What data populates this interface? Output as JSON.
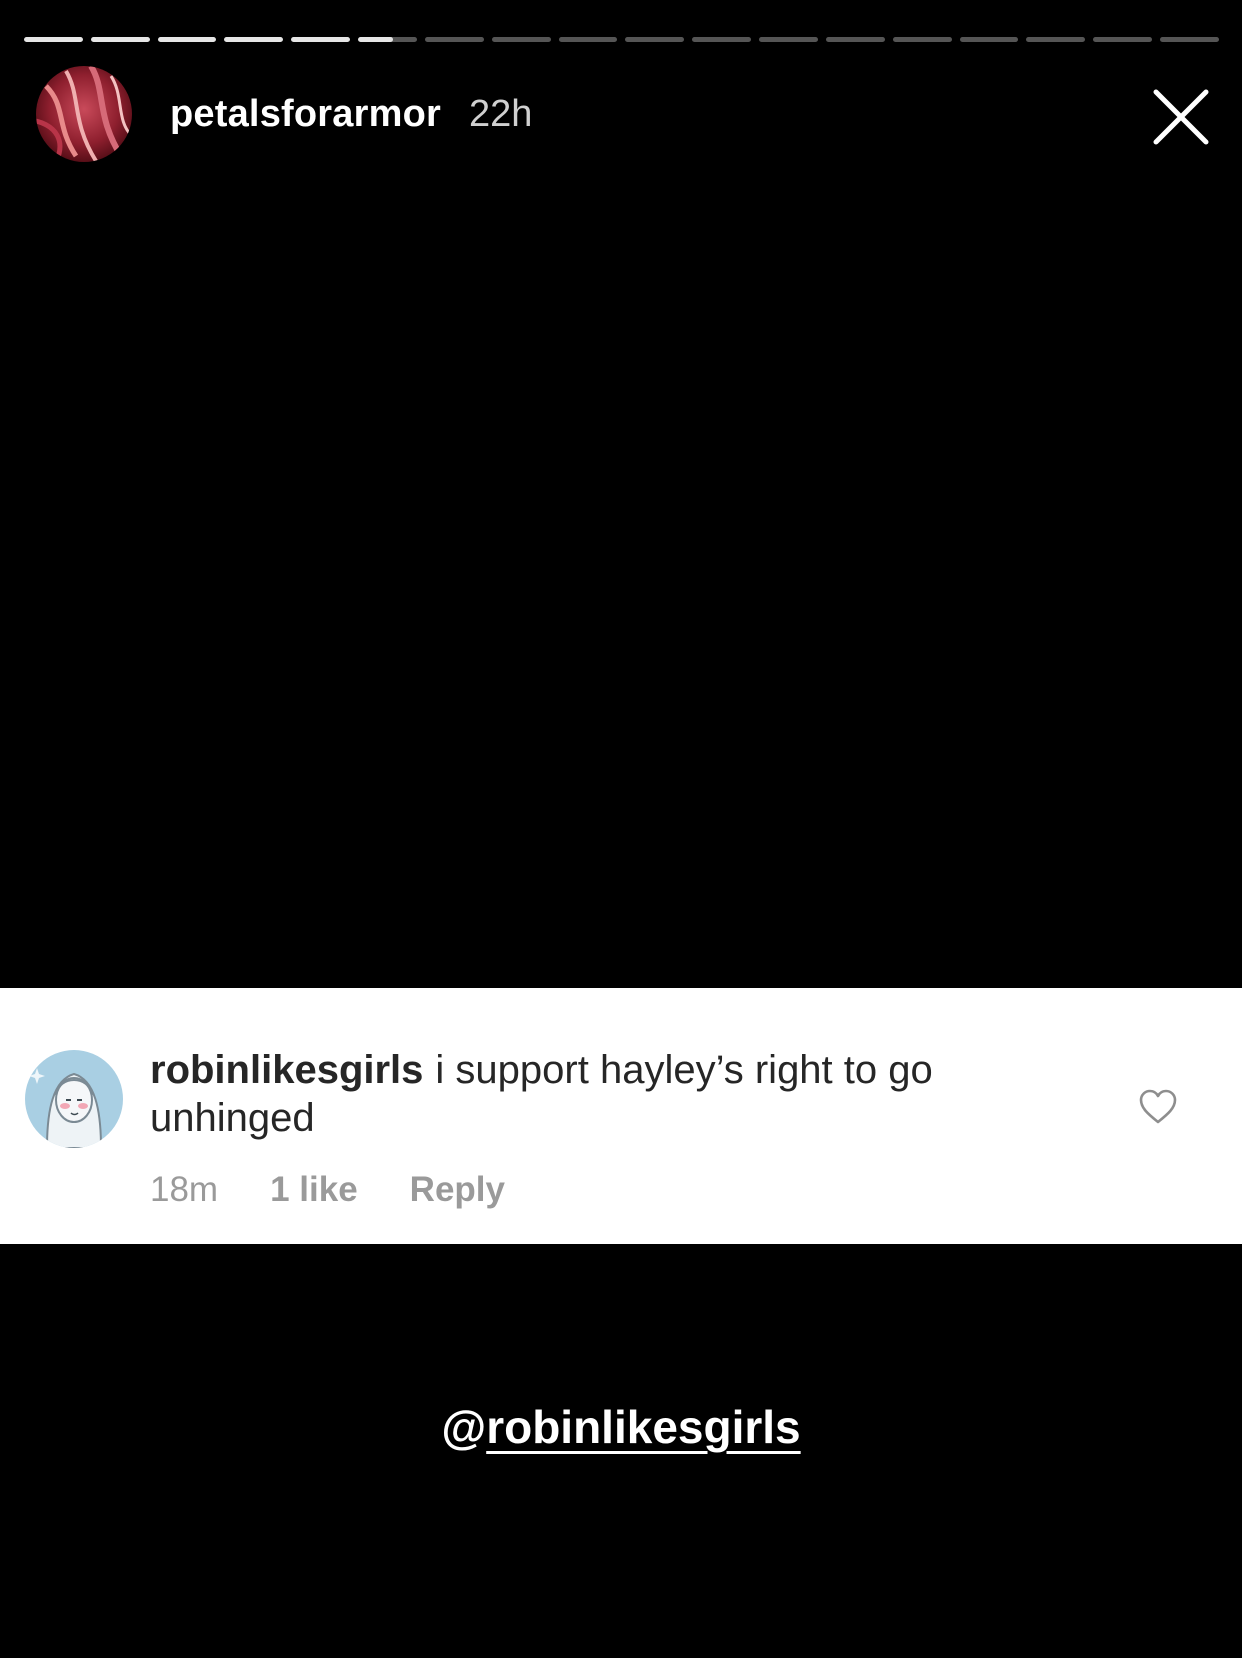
{
  "progress": {
    "segment_count": 18,
    "completed_segments": 5,
    "current_segment_fraction": 0.6
  },
  "header": {
    "username": "petalsforarmor",
    "time": "22h"
  },
  "comment": {
    "username": "robinlikesgirls",
    "text": "i support hayley’s right to go unhinged",
    "age": "18m",
    "likes": "1 like",
    "reply_label": "Reply"
  },
  "mention": {
    "at": "@",
    "handle": "robinlikesgirls"
  },
  "colors": {
    "background": "#000000",
    "progress_track": "#555555",
    "progress_fill": "#e6e6e6",
    "card_background": "#ffffff",
    "comment_text": "#262626",
    "meta_text": "#9a9a9a"
  },
  "icons": {
    "close": "close-icon",
    "like": "heart-icon"
  }
}
